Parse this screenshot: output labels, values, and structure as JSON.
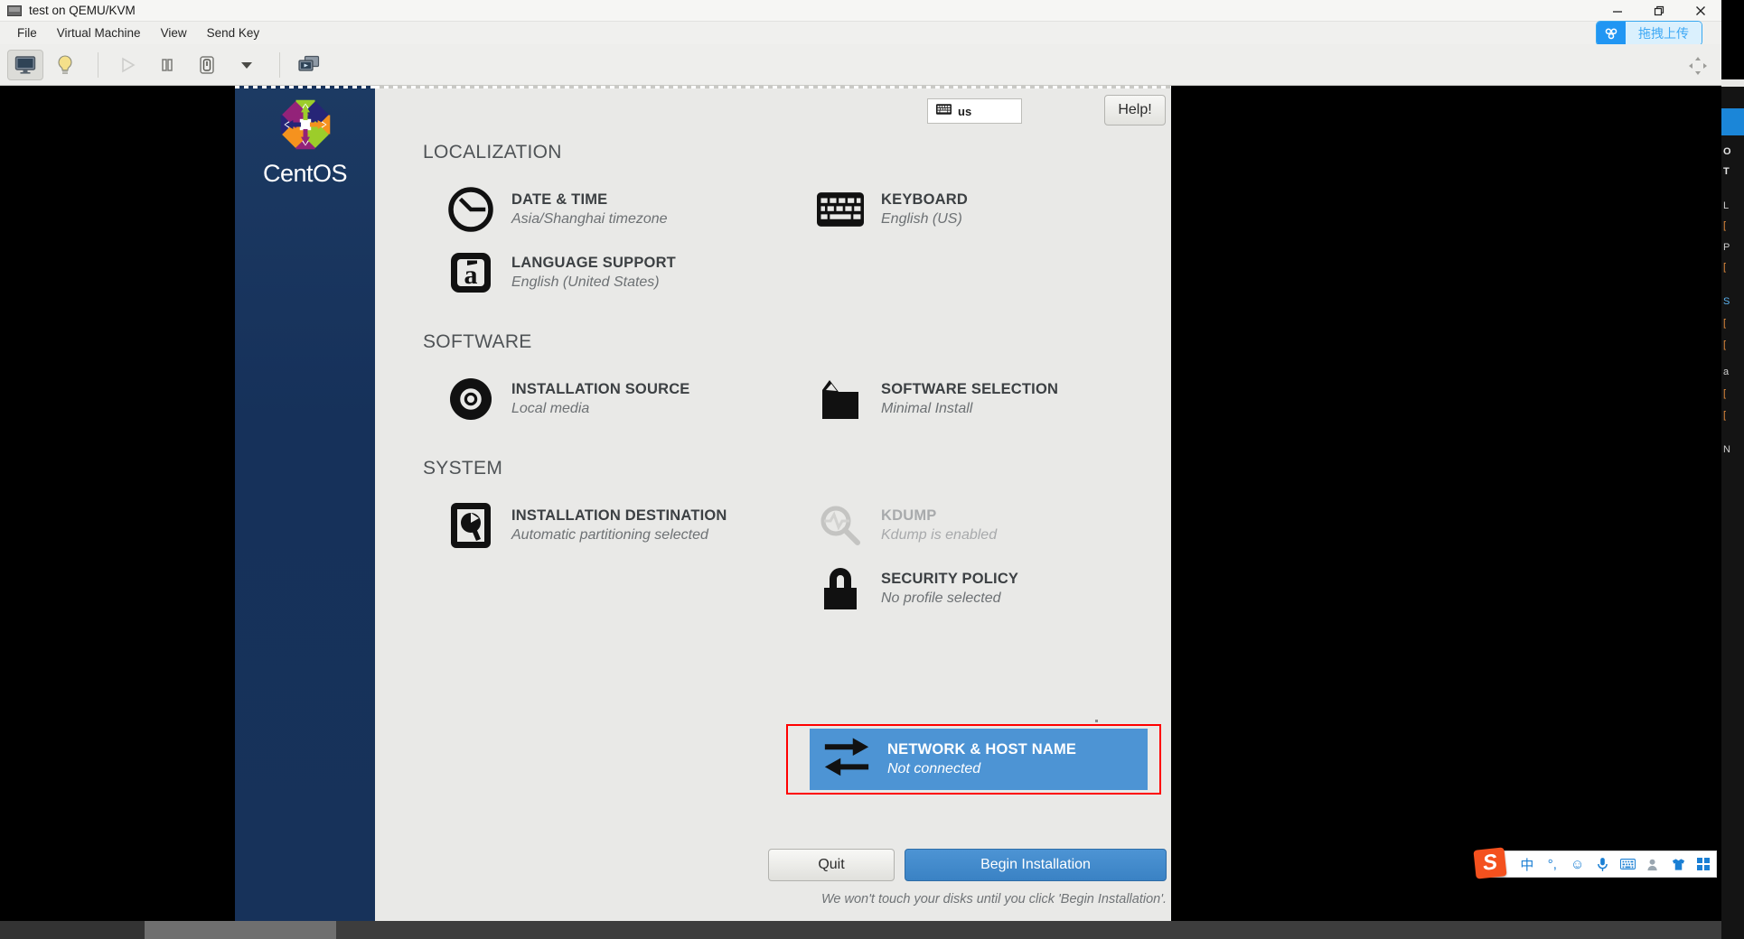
{
  "window": {
    "title": "test on QEMU/KVM",
    "title_icon": "vm-monitor-icon",
    "minimize": "minimize-icon",
    "maximize": "maximize-icon",
    "close": "close-icon"
  },
  "menubar": {
    "items": [
      {
        "label": "File"
      },
      {
        "label": "Virtual Machine"
      },
      {
        "label": "View"
      },
      {
        "label": "Send Key"
      }
    ],
    "upload_button": {
      "label": "拖拽上传",
      "icon": "cloud-upload-icon",
      "accent": "#2196f3",
      "bg": "#daf0fd"
    }
  },
  "toolbar": {
    "buttons": [
      {
        "name": "show-console",
        "icon": "monitor-icon",
        "active": true
      },
      {
        "name": "show-details",
        "icon": "lightbulb-icon",
        "active": false
      },
      {
        "name": "run-vm",
        "icon": "play-icon",
        "disabled": true
      },
      {
        "name": "pause-vm",
        "icon": "pause-icon",
        "disabled": false
      },
      {
        "name": "shutdown-vm",
        "icon": "power-icon",
        "disabled": false
      },
      {
        "name": "shutdown-menu",
        "icon": "chevron-down-icon",
        "disabled": false
      },
      {
        "name": "fullscreen-snapshot",
        "icon": "screens-icon",
        "disabled": false
      }
    ],
    "right_icon": "resize-icon"
  },
  "anaconda": {
    "brand": "CentOS",
    "brand_logo": "centos-swirl-logo",
    "keyboard_layout": {
      "icon": "keyboard-icon",
      "label": "us"
    },
    "help_button": "Help!",
    "sections": [
      {
        "id": "localization",
        "title": "LOCALIZATION",
        "columns": [
          [
            {
              "icon": "clock-icon",
              "title": "DATE & TIME",
              "sub": "Asia/Shanghai timezone",
              "state": "normal"
            },
            {
              "icon": "a-accent-icon",
              "title": "LANGUAGE SUPPORT",
              "sub": "English (United States)",
              "state": "normal"
            }
          ],
          [
            {
              "icon": "keyboard-icon",
              "title": "KEYBOARD",
              "sub": "English (US)",
              "state": "normal"
            }
          ]
        ]
      },
      {
        "id": "software",
        "title": "SOFTWARE",
        "columns": [
          [
            {
              "icon": "disc-icon",
              "title": "INSTALLATION SOURCE",
              "sub": "Local media",
              "state": "normal"
            }
          ],
          [
            {
              "icon": "package-icon",
              "title": "SOFTWARE SELECTION",
              "sub": "Minimal Install",
              "state": "normal"
            }
          ]
        ]
      },
      {
        "id": "system",
        "title": "SYSTEM",
        "columns": [
          [
            {
              "icon": "harddrive-icon",
              "title": "INSTALLATION DESTINATION",
              "sub": "Automatic partitioning selected",
              "state": "normal"
            },
            {
              "icon": "network-icon",
              "title": "NETWORK & HOST NAME",
              "sub": "Not connected",
              "state": "selected"
            }
          ],
          [
            {
              "icon": "magnifier-wave-icon",
              "title": "KDUMP",
              "sub": "Kdump is enabled",
              "state": "disabled"
            },
            {
              "icon": "lock-icon",
              "title": "SECURITY POLICY",
              "sub": "No profile selected",
              "state": "normal"
            }
          ]
        ]
      }
    ],
    "footer": {
      "quit_label": "Quit",
      "begin_label": "Begin Installation",
      "note": "We won't touch your disks until you click 'Begin Installation'."
    },
    "highlight": {
      "color": "#ff0000",
      "selection_color": "#4d94d4"
    }
  },
  "ime": {
    "logo": "S",
    "items": [
      {
        "name": "chinese-mode-icon",
        "glyph": "中"
      },
      {
        "name": "punctuation-icon",
        "glyph": "°,"
      },
      {
        "name": "emoji-icon",
        "glyph": "☺"
      },
      {
        "name": "voice-input-icon",
        "glyph": "🎤"
      },
      {
        "name": "soft-keyboard-icon",
        "glyph": "⌨"
      },
      {
        "name": "account-icon",
        "glyph": "👤"
      },
      {
        "name": "skin-icon",
        "glyph": "👕"
      },
      {
        "name": "toolbox-icon",
        "glyph": "▦"
      }
    ]
  },
  "right_panel": {
    "lines": [
      "O",
      "T",
      "L",
      "[",
      "P",
      "[",
      "S",
      "[",
      "[",
      "a",
      "[",
      "[",
      "N"
    ]
  }
}
